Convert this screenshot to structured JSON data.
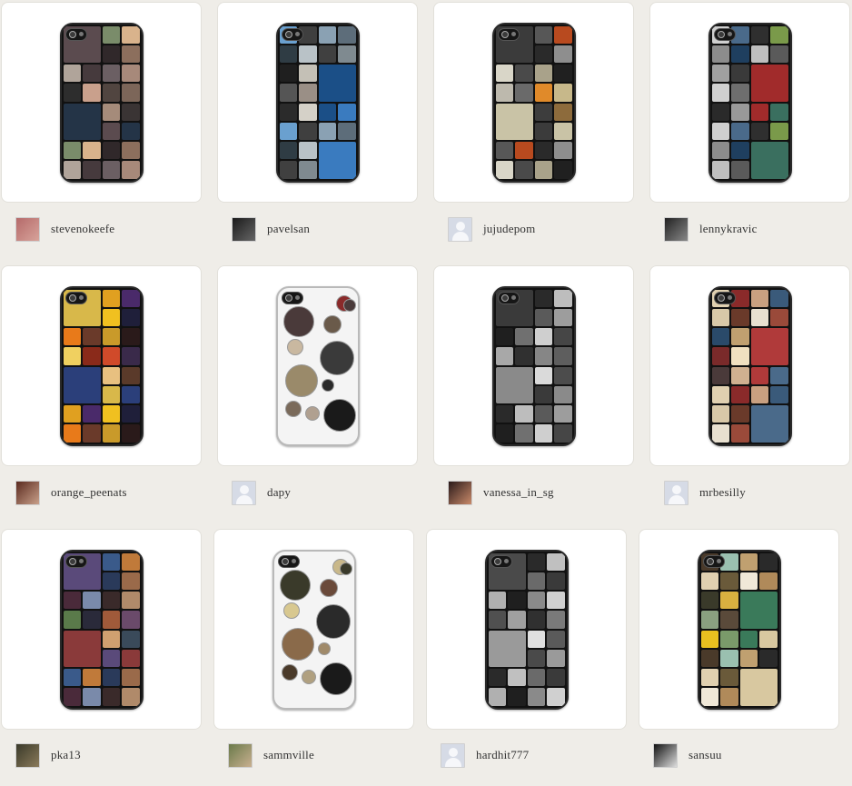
{
  "colors": {
    "background": "#efede8",
    "card": "#ffffff"
  },
  "cases": [
    {
      "username": "stevenokeefe",
      "avatar": "photo",
      "avatar_colors": [
        "#b56a6a",
        "#d7a39a"
      ],
      "style": "grid",
      "palette": [
        "#5b4b4f",
        "#243447",
        "#7a8c6a",
        "#d9b38c",
        "#30282a",
        "#8c6f5d",
        "#b0a49a",
        "#463a3d",
        "#6b5f63",
        "#a7897a",
        "#2d2d2d",
        "#c9a08c",
        "#514540",
        "#7c6659",
        "#a58b7a",
        "#3a3434"
      ]
    },
    {
      "username": "pavelsan",
      "avatar": "photo",
      "avatar_colors": [
        "#1a1a1a",
        "#666666"
      ],
      "style": "grid",
      "palette": [
        "#1b4f87",
        "#3a7bbf",
        "#6aa0cf",
        "#3f3f3f",
        "#8aa1b3",
        "#5d6d7a",
        "#2f3c44",
        "#b9c2c7",
        "#404040",
        "#7f8a90",
        "#1f1f1f",
        "#c4c0b6",
        "#555555",
        "#9a8f86",
        "#2b2b2b",
        "#d5d1c8"
      ]
    },
    {
      "username": "jujudepom",
      "avatar": "default",
      "style": "grid",
      "palette": [
        "#3b3b3b",
        "#c9c3a6",
        "#575757",
        "#b84a1f",
        "#2a2a2a",
        "#8e8e8e",
        "#d9d6c8",
        "#4a4a4a",
        "#a9a28a",
        "#202020",
        "#bdb9ad",
        "#6a6a6a",
        "#e08a2a",
        "#c7b88a",
        "#3d3d3d",
        "#8d6b3c"
      ]
    },
    {
      "username": "lennykravic",
      "avatar": "photo",
      "avatar_colors": [
        "#222222",
        "#888888"
      ],
      "style": "grid",
      "palette": [
        "#a12b2b",
        "#3a6f5f",
        "#cfcfcf",
        "#4a6a8a",
        "#2f2f2f",
        "#7a9a4a",
        "#8c8c8c",
        "#1f3f5f",
        "#bfbfbf",
        "#5a5a5a",
        "#a0a0a0",
        "#3a3a3a",
        "#d0d0d0",
        "#6e6e6e",
        "#2a2a2a",
        "#999999"
      ]
    },
    {
      "username": "orange_peenats",
      "avatar": "photo",
      "avatar_colors": [
        "#5a2a1f",
        "#c9a08a"
      ],
      "style": "grid",
      "palette": [
        "#d8b84a",
        "#2b3f7a",
        "#e0a020",
        "#4a2a6a",
        "#f0c020",
        "#1f1f3a",
        "#e87a1a",
        "#6a3a2a",
        "#c99a2a",
        "#2a1a1a",
        "#f0d060",
        "#8a2a1a",
        "#d04a2a",
        "#3a2a4a",
        "#e8c080",
        "#5a3a2a"
      ]
    },
    {
      "username": "dapy",
      "avatar": "default",
      "style": "bubbles",
      "palette": [
        "#4a3a3a",
        "#8a2a2a",
        "#6a5a4a",
        "#c9b8a0",
        "#3a3a3a",
        "#9a8a6a",
        "#2a2a2a",
        "#7a6a5a",
        "#b0a090",
        "#1a1a1a"
      ]
    },
    {
      "username": "vanessa_in_sg",
      "avatar": "photo",
      "avatar_colors": [
        "#2a1a1a",
        "#c98a6a"
      ],
      "style": "grid",
      "palette": [
        "#3a3a3a",
        "#8a8a8a",
        "#2a2a2a",
        "#bdbdbd",
        "#5a5a5a",
        "#9d9d9d",
        "#1f1f1f",
        "#707070",
        "#cfcfcf",
        "#464646",
        "#a8a8a8",
        "#303030",
        "#868686",
        "#5e5e5e",
        "#dadada",
        "#4c4c4c"
      ]
    },
    {
      "username": "mrbesilly",
      "avatar": "default",
      "style": "grid",
      "palette": [
        "#b03a3a",
        "#4a6a8a",
        "#e0d0b0",
        "#8a2a2a",
        "#c9a080",
        "#3a5a7a",
        "#d8c8a8",
        "#6a3a2a",
        "#e8e0d0",
        "#9a4a3a",
        "#2a4a6a",
        "#c0a070",
        "#7a2a2a",
        "#f0e0c0",
        "#4a3a3a",
        "#d0b090"
      ]
    },
    {
      "username": "pka13",
      "avatar": "photo",
      "avatar_colors": [
        "#3a3a2a",
        "#8a7a5a"
      ],
      "style": "grid",
      "palette": [
        "#5a4a7a",
        "#8a3a3a",
        "#3a5a8a",
        "#c07a3a",
        "#2a3a5a",
        "#9a6a4a",
        "#4a2a3a",
        "#7a8aaa",
        "#3a2a2a",
        "#b08a6a",
        "#5a7a4a",
        "#2a2a3a",
        "#a05a3a",
        "#6a4a6a",
        "#d0a070",
        "#3a4a5a"
      ]
    },
    {
      "username": "sammville",
      "avatar": "photo",
      "avatar_colors": [
        "#6a7a4a",
        "#c9b090"
      ],
      "style": "bubbles",
      "palette": [
        "#3a3a2a",
        "#c9b88a",
        "#6a4a3a",
        "#d8c890",
        "#2a2a2a",
        "#8a6a4a",
        "#a08a6a",
        "#4a3a2a",
        "#b0a080",
        "#1a1a1a"
      ]
    },
    {
      "username": "hardhit777",
      "avatar": "default",
      "style": "grid",
      "palette": [
        "#4a4a4a",
        "#9a9a9a",
        "#2a2a2a",
        "#c0c0c0",
        "#6a6a6a",
        "#3a3a3a",
        "#b0b0b0",
        "#1f1f1f",
        "#8a8a8a",
        "#d0d0d0",
        "#505050",
        "#a0a0a0",
        "#303030",
        "#7a7a7a",
        "#e0e0e0",
        "#5a5a5a"
      ]
    },
    {
      "username": "sansuu",
      "avatar": "photo",
      "avatar_colors": [
        "#111111",
        "#dddddd"
      ],
      "style": "grid",
      "palette": [
        "#3a7a5a",
        "#d8c8a0",
        "#4a3a2a",
        "#9ac0b0",
        "#c0a070",
        "#2a2a2a",
        "#e0d0b0",
        "#6a5a3a",
        "#f0e8d8",
        "#b08a5a",
        "#3a3a2a",
        "#d8b040",
        "#8aa080",
        "#5a4a3a",
        "#e8c020",
        "#7a9a6a"
      ]
    }
  ]
}
